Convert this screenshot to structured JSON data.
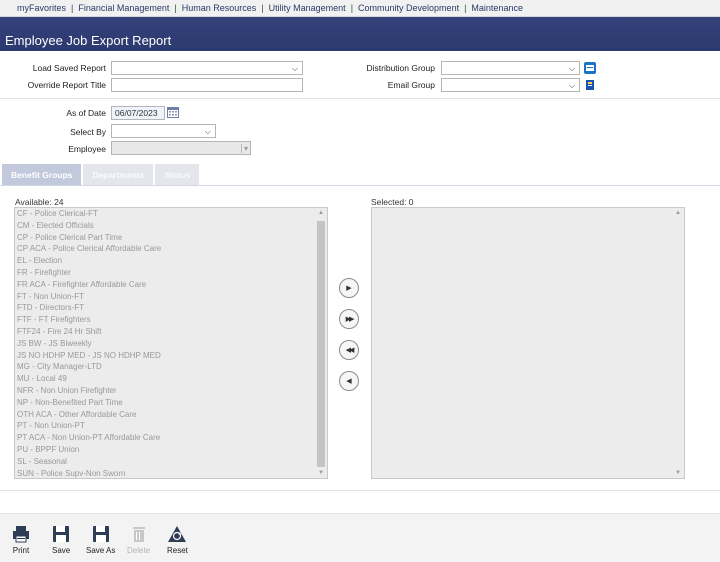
{
  "nav": [
    "myFavorites",
    "Financial Management",
    "Human Resources",
    "Utility Management",
    "Community Development",
    "Maintenance"
  ],
  "nav_separator": "|",
  "page_title": "Employee Job Export Report",
  "form": {
    "load_saved_report_label": "Load Saved Report",
    "override_title_label": "Override Report Title",
    "distribution_group_label": "Distribution Group",
    "email_group_label": "Email Group",
    "as_of_date_label": "As of Date",
    "as_of_date_value": "06/07/2023",
    "select_by_label": "Select By",
    "employee_label": "Employee"
  },
  "tabs": [
    {
      "label": "Benefit Groups",
      "active": true
    },
    {
      "label": "Departments",
      "active": false
    },
    {
      "label": "Status",
      "active": false
    }
  ],
  "available_label": "Available: 24",
  "selected_label": "Selected: 0",
  "available_items": [
    "CF - Police Clerical-FT",
    "CM - Elected Officials",
    "CP - Police Clerical Part Time",
    "CP ACA - Police Clerical Affordable Care",
    "EL - Election",
    "FR - Firefighter",
    "FR ACA - Firefighter Affordable Care",
    "FT - Non Union-FT",
    "FTD - Directors-FT",
    "FTF - FT Firefighters",
    "FTF24 - Fire 24 Hr Shift",
    "JS BW - JS Biweekly",
    "JS NO HDHP MED - JS NO HDHP MED",
    "MG - City Manager-LTD",
    "MU - Local 49",
    "NFR - Non Union Firefighter",
    "NP - Non-Benefited Part Time",
    "OTH ACA - Other Affordable Care",
    "PT - Non Union-PT",
    "PT ACA - Non Union-PT Affordable Care",
    "PU - BPPF Union",
    "SL - Seasonal",
    "SUN - Police Supv-Non Sworn"
  ],
  "toolbar": {
    "print": "Print",
    "save": "Save",
    "save_as": "Save As",
    "delete": "Delete",
    "reset": "Reset"
  },
  "colors": {
    "header_bg": "#2f3c73",
    "tab_active": "#c3c9dc",
    "accent_blue": "#1a73c7"
  }
}
